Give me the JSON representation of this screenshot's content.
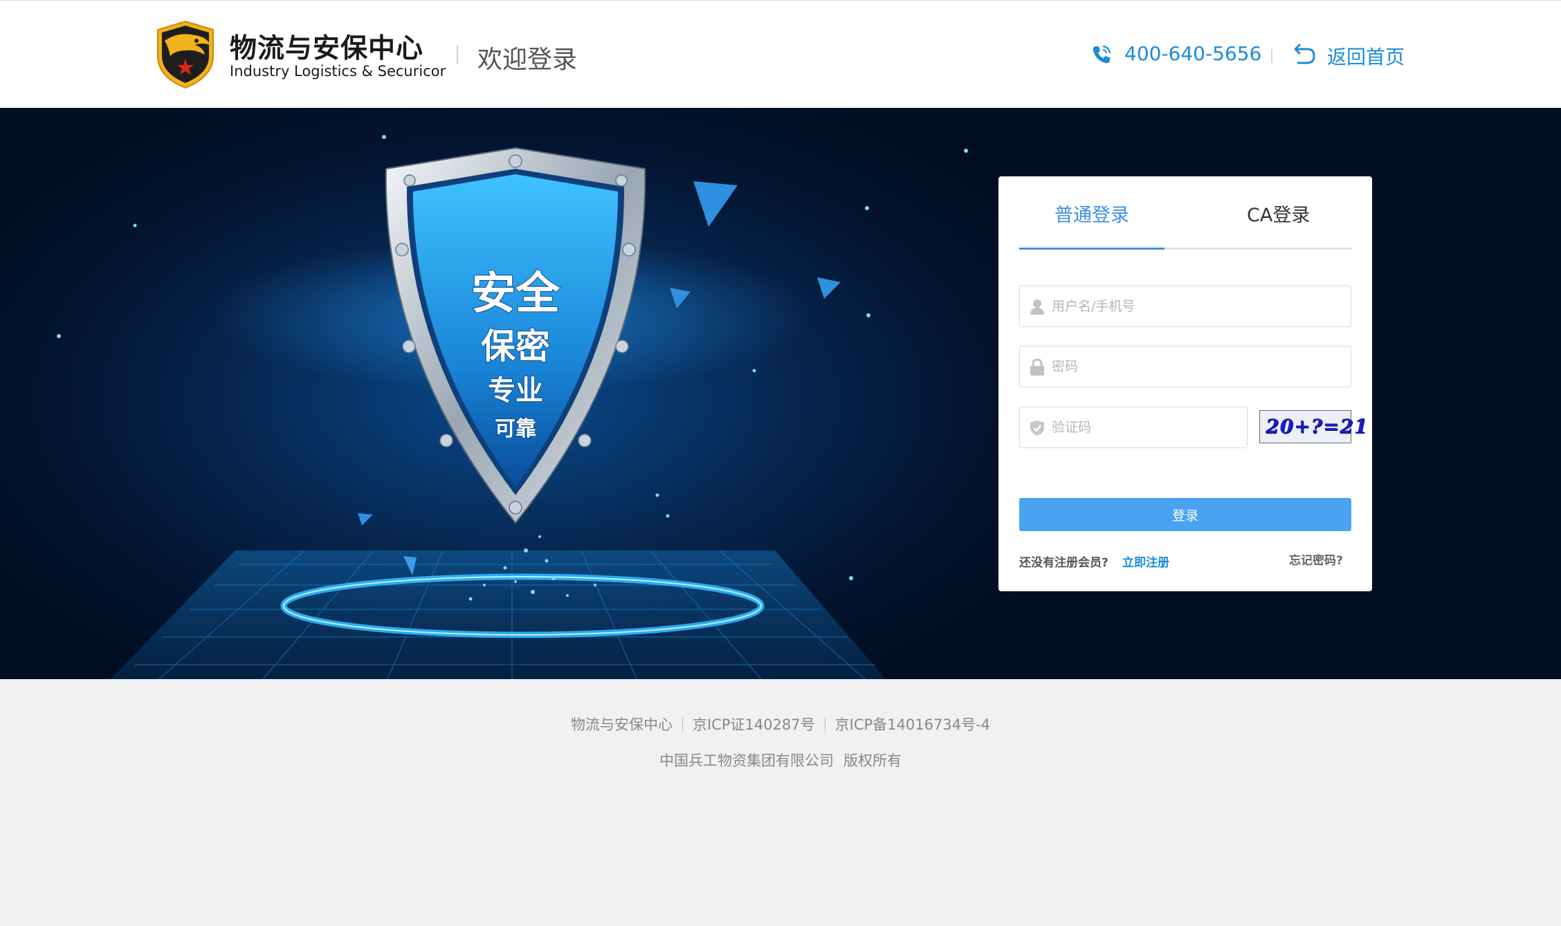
{
  "header": {
    "logo_cn": "物流与安保中心",
    "logo_en": "Industry Logistics & Securicor",
    "welcome": "欢迎登录",
    "phone": "400-640-5656",
    "home_link": "返回首页",
    "accent_color": "#1a8cd8"
  },
  "banner": {
    "shield_lines": [
      "安全",
      "保密",
      "专业",
      "可靠"
    ]
  },
  "login": {
    "tabs": [
      {
        "label": "普通登录",
        "active": true
      },
      {
        "label": "CA登录",
        "active": false
      }
    ],
    "username_placeholder": "用户名/手机号",
    "password_placeholder": "密码",
    "captcha_placeholder": "验证码",
    "captcha_text": "20+?=21",
    "submit_label": "登录",
    "no_account_text": "还没有注册会员?",
    "register_link": "立即注册",
    "forgot_link": "忘记密码?",
    "button_color": "#4aa2f2"
  },
  "footer": {
    "site_name": "物流与安保中心",
    "icp_license": "京ICP证140287号",
    "icp_record": "京ICP备14016734号-4",
    "company": "中国兵工物资集团有限公司",
    "copyright": "版权所有"
  }
}
